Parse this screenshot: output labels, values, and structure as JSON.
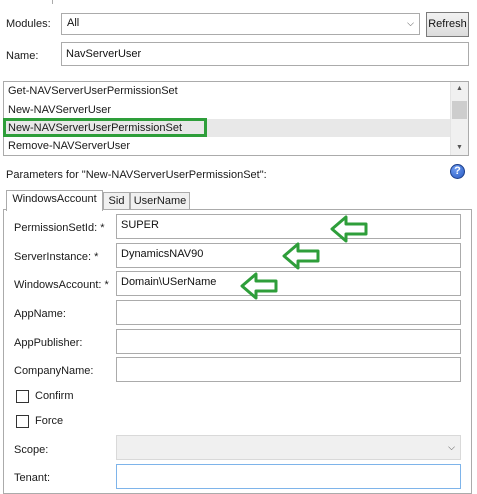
{
  "modules": {
    "label": "Modules:",
    "value": "All",
    "refresh_label": "Refresh"
  },
  "name": {
    "label": "Name:",
    "value": "NavServerUser"
  },
  "commands": [
    "Get-NAVServerUserPermissionSet",
    "New-NAVServerUser",
    "New-NAVServerUserPermissionSet",
    "Remove-NAVServerUser"
  ],
  "parameters_heading": "Parameters for \"New-NAVServerUserPermissionSet\":",
  "help_icon_glyph": "?",
  "tabs": [
    "WindowsAccount",
    "Sid",
    "UserName"
  ],
  "fields": {
    "permission_set_id": {
      "label": "PermissionSetId: *",
      "value": "SUPER"
    },
    "server_instance": {
      "label": "ServerInstance: *",
      "value": "DynamicsNAV90"
    },
    "windows_account": {
      "label": "WindowsAccount: *",
      "value": "Domain\\USerName"
    },
    "app_name": {
      "label": "AppName:",
      "value": ""
    },
    "app_publisher": {
      "label": "AppPublisher:",
      "value": ""
    },
    "company_name": {
      "label": "CompanyName:",
      "value": ""
    },
    "confirm": {
      "label": "Confirm",
      "checked": false
    },
    "force": {
      "label": "Force",
      "checked": false
    },
    "scope": {
      "label": "Scope:",
      "value": ""
    },
    "tenant": {
      "label": "Tenant:",
      "value": ""
    }
  },
  "colors": {
    "annotation_green": "#2e9e3a",
    "help_blue": "#2a5cc4",
    "selection_gray": "#e8e8e8"
  },
  "icons": {
    "annotation_arrow": "left-arrow-icon",
    "help": "help-icon",
    "dropdown": "chevron-down-icon"
  }
}
